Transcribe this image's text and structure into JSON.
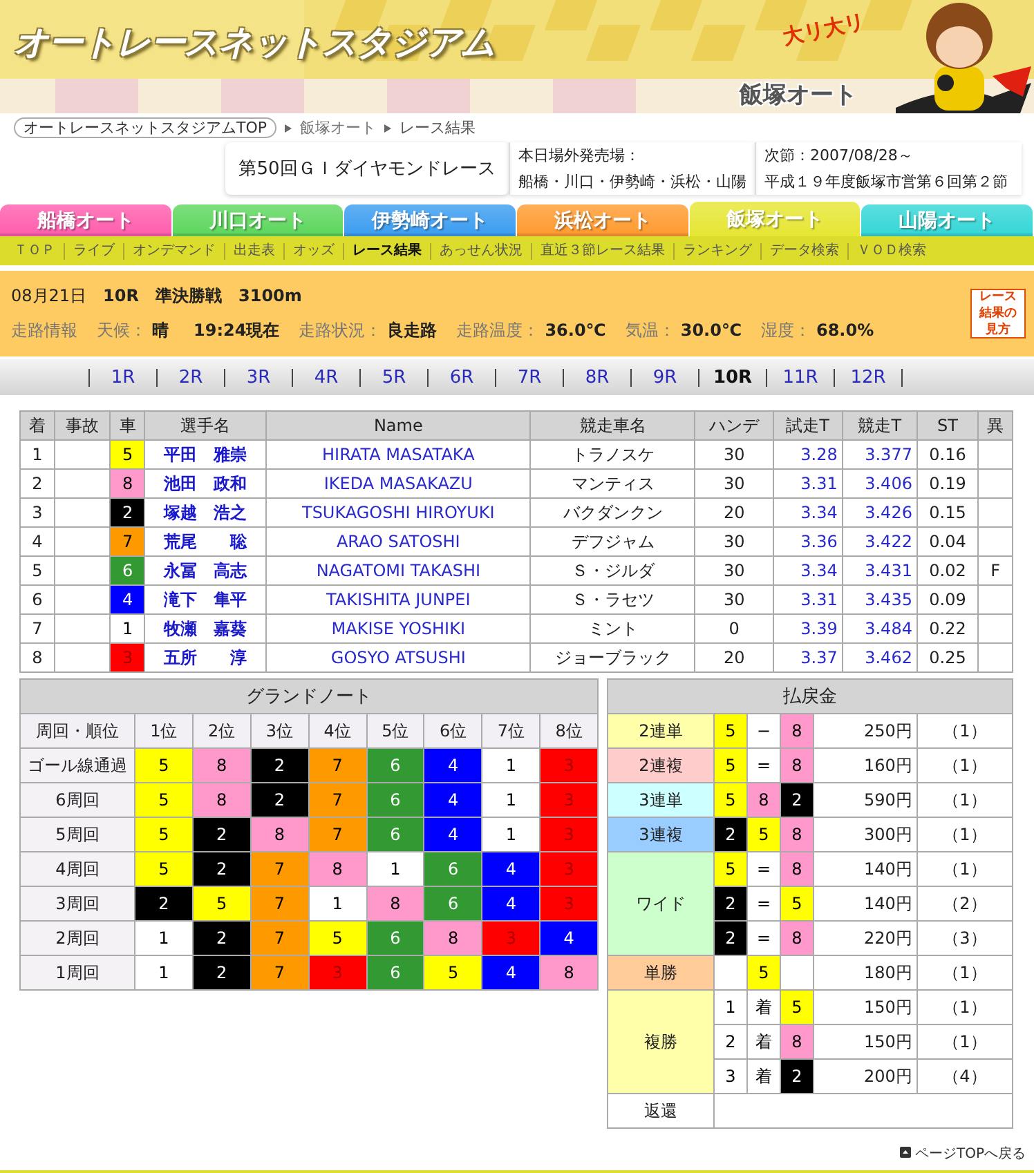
{
  "header": {
    "logo": "オートレースネットスタジアム",
    "venue": "飯塚オート",
    "mascot_caption": "大リ大リ"
  },
  "breadcrumb": [
    {
      "label": "オートレースネットスタジアムTOP",
      "kind": "pill"
    },
    {
      "label": "飯塚オート",
      "kind": "link"
    },
    {
      "label": "レース結果",
      "kind": "current"
    }
  ],
  "race_title": "第50回ＧＩダイヤモンドレース",
  "outside_sales": {
    "label": "本日場外発売場：",
    "venues": "船橋・川口・伊勢崎・浜松・山陽"
  },
  "next_meet": {
    "date": "次節：2007/08/28～",
    "name": "平成１９年度飯塚市営第６回第２節"
  },
  "venue_tabs": [
    {
      "label": "船橋オート",
      "color": "#ff5cad",
      "selected": false
    },
    {
      "label": "川口オート",
      "color": "#5cd65c",
      "selected": false
    },
    {
      "label": "伊勢崎オート",
      "color": "#3a9cf0",
      "selected": false
    },
    {
      "label": "浜松オート",
      "color": "#ff9a2e",
      "selected": false
    },
    {
      "label": "飯塚オート",
      "color": "#e6e633",
      "selected": true
    },
    {
      "label": "山陽オート",
      "color": "#33d6d6",
      "selected": false
    }
  ],
  "sub_nav": [
    {
      "label": "ＴＯＰ",
      "selected": false
    },
    {
      "label": "ライブ",
      "selected": false
    },
    {
      "label": "オンデマンド",
      "selected": false
    },
    {
      "label": "出走表",
      "selected": false
    },
    {
      "label": "オッズ",
      "selected": false
    },
    {
      "label": "レース結果",
      "selected": true
    },
    {
      "label": "あっせん状況",
      "selected": false
    },
    {
      "label": "直近３節レース結果",
      "selected": false
    },
    {
      "label": "ランキング",
      "selected": false
    },
    {
      "label": "データ検索",
      "selected": false
    },
    {
      "label": "ＶＯＤ検索",
      "selected": false
    }
  ],
  "race_info": {
    "date": "08月21日",
    "race": "10R",
    "stage": "準決勝戦",
    "distance": "3100m",
    "section_label": "走路情報",
    "conditions": [
      {
        "label": "天候：",
        "value": "晴",
        "time": "19:24現在"
      },
      {
        "label": "走路状況：",
        "value": "良走路"
      },
      {
        "label": "走路温度：",
        "value": "36.0℃"
      },
      {
        "label": "気温：",
        "value": "30.0℃"
      },
      {
        "label": "湿度：",
        "value": "68.0%"
      }
    ],
    "guide_button": "レース結果の見方"
  },
  "race_nav": [
    {
      "label": "1R",
      "selected": false
    },
    {
      "label": "2R",
      "selected": false
    },
    {
      "label": "3R",
      "selected": false
    },
    {
      "label": "4R",
      "selected": false
    },
    {
      "label": "5R",
      "selected": false
    },
    {
      "label": "6R",
      "selected": false
    },
    {
      "label": "7R",
      "selected": false
    },
    {
      "label": "8R",
      "selected": false
    },
    {
      "label": "9R",
      "selected": false
    },
    {
      "label": "10R",
      "selected": true
    },
    {
      "label": "11R",
      "selected": false
    },
    {
      "label": "12R",
      "selected": false
    }
  ],
  "results": {
    "columns": [
      "着",
      "事故",
      "車",
      "選手名",
      "Name",
      "競走車名",
      "ハンデ",
      "試走T",
      "競走T",
      "ST",
      "異"
    ],
    "rows": [
      {
        "rank": "1",
        "car": "5",
        "color": "#ffff00",
        "name": "平田　雅崇",
        "name_en": "HIRATA MASATAKA",
        "machine": "トラノスケ",
        "handicap": "30",
        "trial": "3.28",
        "time": "3.377",
        "st": "0.16"
      },
      {
        "rank": "2",
        "car": "8",
        "color": "#ff99cc",
        "name": "池田　政和",
        "name_en": "IKEDA MASAKAZU",
        "machine": "マンティス",
        "handicap": "30",
        "trial": "3.31",
        "time": "3.406",
        "st": "0.19"
      },
      {
        "rank": "3",
        "car": "2",
        "color": "#000000",
        "name": "塚越　浩之",
        "name_en": "TSUKAGOSHI HIROYUKI",
        "machine": "バクダンクン",
        "handicap": "20",
        "trial": "3.34",
        "time": "3.426",
        "st": "0.15"
      },
      {
        "rank": "4",
        "car": "7",
        "color": "#ff9900",
        "name": "荒尾　　聡",
        "name_en": "ARAO SATOSHI",
        "machine": "デフジャム",
        "handicap": "30",
        "trial": "3.36",
        "time": "3.422",
        "st": "0.04"
      },
      {
        "rank": "5",
        "car": "6",
        "color": "#339933",
        "name": "永冨　高志",
        "name_en": "NAGATOMI TAKASHI",
        "machine": "Ｓ・ジルダ",
        "handicap": "30",
        "trial": "3.34",
        "time": "3.431",
        "st": "0.02",
        "flag": "F"
      },
      {
        "rank": "6",
        "car": "4",
        "color": "#0000ff",
        "name": "滝下　隼平",
        "name_en": "TAKISHITA JUNPEI",
        "machine": "Ｓ・ラセツ",
        "handicap": "30",
        "trial": "3.31",
        "time": "3.435",
        "st": "0.09"
      },
      {
        "rank": "7",
        "car": "1",
        "color": "#ffffff",
        "name": "牧瀬　嘉葵",
        "name_en": "MAKISE YOSHIKI",
        "machine": "ミント",
        "handicap": "0",
        "trial": "3.39",
        "time": "3.484",
        "st": "0.22"
      },
      {
        "rank": "8",
        "car": "3",
        "color": "#ff0000",
        "name": "五所　　淳",
        "name_en": "GOSYO ATSUSHI",
        "machine": "ジョーブラック",
        "handicap": "20",
        "trial": "3.37",
        "time": "3.462",
        "st": "0.25"
      }
    ]
  },
  "grand_note": {
    "title": "グランドノート",
    "corner_label": "周回・順位",
    "columns": [
      "1位",
      "2位",
      "3位",
      "4位",
      "5位",
      "6位",
      "7位",
      "8位"
    ],
    "rows": [
      {
        "label": "ゴール線通過",
        "cells": [
          {
            "car": "5",
            "color": "#ffff00"
          },
          {
            "car": "8",
            "color": "#ff99cc"
          },
          {
            "car": "2",
            "color": "#000000"
          },
          {
            "car": "7",
            "color": "#ff9900"
          },
          {
            "car": "6",
            "color": "#339933"
          },
          {
            "car": "4",
            "color": "#0000ff"
          },
          {
            "car": "1",
            "color": "#ffffff"
          },
          {
            "car": "3",
            "color": "#ff0000"
          }
        ]
      },
      {
        "label": "6周回",
        "cells": [
          {
            "car": "5",
            "color": "#ffff00"
          },
          {
            "car": "8",
            "color": "#ff99cc"
          },
          {
            "car": "2",
            "color": "#000000"
          },
          {
            "car": "7",
            "color": "#ff9900"
          },
          {
            "car": "6",
            "color": "#339933"
          },
          {
            "car": "4",
            "color": "#0000ff"
          },
          {
            "car": "1",
            "color": "#ffffff"
          },
          {
            "car": "3",
            "color": "#ff0000"
          }
        ]
      },
      {
        "label": "5周回",
        "cells": [
          {
            "car": "5",
            "color": "#ffff00"
          },
          {
            "car": "2",
            "color": "#000000"
          },
          {
            "car": "8",
            "color": "#ff99cc"
          },
          {
            "car": "7",
            "color": "#ff9900"
          },
          {
            "car": "6",
            "color": "#339933"
          },
          {
            "car": "4",
            "color": "#0000ff"
          },
          {
            "car": "1",
            "color": "#ffffff"
          },
          {
            "car": "3",
            "color": "#ff0000"
          }
        ]
      },
      {
        "label": "4周回",
        "cells": [
          {
            "car": "5",
            "color": "#ffff00"
          },
          {
            "car": "2",
            "color": "#000000"
          },
          {
            "car": "7",
            "color": "#ff9900"
          },
          {
            "car": "8",
            "color": "#ff99cc"
          },
          {
            "car": "1",
            "color": "#ffffff"
          },
          {
            "car": "6",
            "color": "#339933"
          },
          {
            "car": "4",
            "color": "#0000ff"
          },
          {
            "car": "3",
            "color": "#ff0000"
          }
        ]
      },
      {
        "label": "3周回",
        "cells": [
          {
            "car": "2",
            "color": "#000000"
          },
          {
            "car": "5",
            "color": "#ffff00"
          },
          {
            "car": "7",
            "color": "#ff9900"
          },
          {
            "car": "1",
            "color": "#ffffff"
          },
          {
            "car": "8",
            "color": "#ff99cc"
          },
          {
            "car": "6",
            "color": "#339933"
          },
          {
            "car": "4",
            "color": "#0000ff"
          },
          {
            "car": "3",
            "color": "#ff0000"
          }
        ]
      },
      {
        "label": "2周回",
        "cells": [
          {
            "car": "1",
            "color": "#ffffff"
          },
          {
            "car": "2",
            "color": "#000000"
          },
          {
            "car": "7",
            "color": "#ff9900"
          },
          {
            "car": "5",
            "color": "#ffff00"
          },
          {
            "car": "6",
            "color": "#339933"
          },
          {
            "car": "8",
            "color": "#ff99cc"
          },
          {
            "car": "3",
            "color": "#ff0000"
          },
          {
            "car": "4",
            "color": "#0000ff"
          }
        ]
      },
      {
        "label": "1周回",
        "cells": [
          {
            "car": "1",
            "color": "#ffffff"
          },
          {
            "car": "2",
            "color": "#000000"
          },
          {
            "car": "7",
            "color": "#ff9900"
          },
          {
            "car": "3",
            "color": "#ff0000"
          },
          {
            "car": "6",
            "color": "#339933"
          },
          {
            "car": "5",
            "color": "#ffff00"
          },
          {
            "car": "4",
            "color": "#0000ff"
          },
          {
            "car": "8",
            "color": "#ff99cc"
          }
        ]
      }
    ]
  },
  "payout": {
    "title": "払戻金",
    "groups": [
      {
        "label": "2連単",
        "color": "#ffffaa",
        "rows": [
          {
            "slots": [
              {
                "kind": "car",
                "text": "5",
                "color": "#ffff00"
              },
              {
                "kind": "mark",
                "text": "−"
              },
              {
                "kind": "car",
                "text": "8",
                "color": "#ff99cc"
              }
            ],
            "amount": "250円",
            "popularity": "（1）"
          }
        ]
      },
      {
        "label": "2連複",
        "color": "#ffcccc",
        "rows": [
          {
            "slots": [
              {
                "kind": "car",
                "text": "5",
                "color": "#ffff00"
              },
              {
                "kind": "mark",
                "text": "="
              },
              {
                "kind": "car",
                "text": "8",
                "color": "#ff99cc"
              }
            ],
            "amount": "160円",
            "popularity": "（1）"
          }
        ]
      },
      {
        "label": "3連単",
        "color": "#ccffff",
        "rows": [
          {
            "slots": [
              {
                "kind": "car",
                "text": "5",
                "color": "#ffff00"
              },
              {
                "kind": "car",
                "text": "8",
                "color": "#ff99cc"
              },
              {
                "kind": "car",
                "text": "2",
                "color": "#000000"
              }
            ],
            "amount": "590円",
            "popularity": "（1）"
          }
        ]
      },
      {
        "label": "3連複",
        "color": "#99ccff",
        "rows": [
          {
            "slots": [
              {
                "kind": "car",
                "text": "2",
                "color": "#000000"
              },
              {
                "kind": "car",
                "text": "5",
                "color": "#ffff00"
              },
              {
                "kind": "car",
                "text": "8",
                "color": "#ff99cc"
              }
            ],
            "amount": "300円",
            "popularity": "（1）"
          }
        ]
      },
      {
        "label": "ワイド",
        "color": "#ccffcc",
        "rows": [
          {
            "slots": [
              {
                "kind": "car",
                "text": "5",
                "color": "#ffff00"
              },
              {
                "kind": "mark",
                "text": "="
              },
              {
                "kind": "car",
                "text": "8",
                "color": "#ff99cc"
              }
            ],
            "amount": "140円",
            "popularity": "（1）"
          },
          {
            "slots": [
              {
                "kind": "car",
                "text": "2",
                "color": "#000000"
              },
              {
                "kind": "mark",
                "text": "="
              },
              {
                "kind": "car",
                "text": "5",
                "color": "#ffff00"
              }
            ],
            "amount": "140円",
            "popularity": "（2）"
          },
          {
            "slots": [
              {
                "kind": "car",
                "text": "2",
                "color": "#000000"
              },
              {
                "kind": "mark",
                "text": "="
              },
              {
                "kind": "car",
                "text": "8",
                "color": "#ff99cc"
              }
            ],
            "amount": "220円",
            "popularity": "（3）"
          }
        ]
      },
      {
        "label": "単勝",
        "color": "#ffcc99",
        "rows": [
          {
            "slots": [
              {
                "kind": "blank"
              },
              {
                "kind": "car",
                "text": "5",
                "color": "#ffff00"
              },
              {
                "kind": "blank"
              }
            ],
            "amount": "180円",
            "popularity": "（1）"
          }
        ]
      },
      {
        "label": "複勝",
        "color": "#ffffaa",
        "rows": [
          {
            "slots": [
              {
                "kind": "mark",
                "text": "1"
              },
              {
                "kind": "mark",
                "text": "着"
              },
              {
                "kind": "car",
                "text": "5",
                "color": "#ffff00"
              }
            ],
            "amount": "150円",
            "popularity": "（1）"
          },
          {
            "slots": [
              {
                "kind": "mark",
                "text": "2"
              },
              {
                "kind": "mark",
                "text": "着"
              },
              {
                "kind": "car",
                "text": "8",
                "color": "#ff99cc"
              }
            ],
            "amount": "150円",
            "popularity": "（1）"
          },
          {
            "slots": [
              {
                "kind": "mark",
                "text": "3"
              },
              {
                "kind": "mark",
                "text": "着"
              },
              {
                "kind": "car",
                "text": "2",
                "color": "#000000"
              }
            ],
            "amount": "200円",
            "popularity": "（4）"
          }
        ]
      },
      {
        "label": "返還",
        "color": "#ffffff"
      }
    ]
  },
  "footer": {
    "back_to_top": "ページTOPへ戻る"
  }
}
